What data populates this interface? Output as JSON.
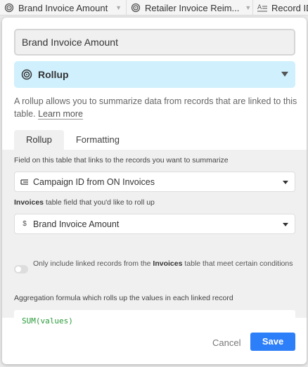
{
  "columns": [
    {
      "label": "Brand Invoice Amount",
      "icon": "rollup-icon"
    },
    {
      "label": "Retailer Invoice Reim...",
      "icon": "rollup-icon"
    },
    {
      "label": "Record ID",
      "icon": "text-field-icon"
    }
  ],
  "dialog": {
    "field_name": "Brand Invoice Amount",
    "type_label": "Rollup",
    "description": "A rollup allows you to summarize data from records that are linked to this table.",
    "learn_more": "Learn more",
    "tabs": [
      "Rollup",
      "Formatting"
    ],
    "link_field_label": "Field on this table that links to the records you want to summarize",
    "link_field_value": "Campaign ID from ON Invoices",
    "rollup_field_label_bold": "Invoices",
    "rollup_field_label_rest": " table field that you'd like to roll up",
    "rollup_field_value": "Brand Invoice Amount",
    "filter_text_prefix": "Only include linked records from the ",
    "filter_text_bold": "Invoices",
    "filter_text_suffix": " table that meet certain conditions",
    "aggregation_label": "Aggregation formula which rolls up the values in each linked record",
    "formula": "SUM(values)",
    "cancel_label": "Cancel",
    "save_label": "Save"
  },
  "colors": {
    "accent": "#2d7ff9",
    "type_bg": "#d0f0fd",
    "formula_text": "#2a9a3a"
  }
}
